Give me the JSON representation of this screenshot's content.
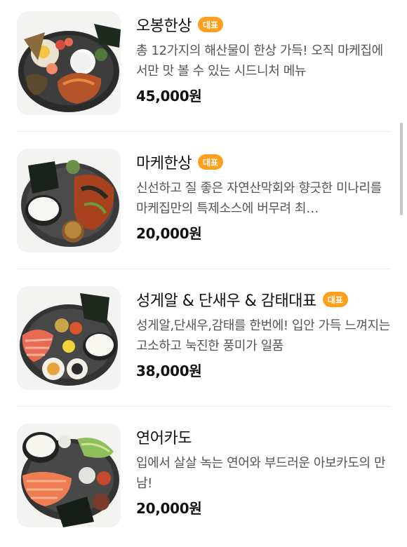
{
  "menu": {
    "items": [
      {
        "name": "오봉한상",
        "badge": "대표",
        "description": "총 12가지의 해산물이 한상 가득! 오직 마케집에서만 맛 볼 수 있는 시드니처 메뉴",
        "price": "45,000원",
        "image": "seafood-platter-photo"
      },
      {
        "name": "마케한상",
        "badge": "대표",
        "description": "신선하고 질 좋은 자연산막회와 향긋한 미나리를 마케집만의 특제소스에 버무려 최…",
        "price": "20,000원",
        "image": "raw-fish-salad-platter-photo"
      },
      {
        "name": "성게알 & 단새우 & 감태대표",
        "badge": "대표",
        "description": "성게알,단새우,감태를 한번에! 입안 가득 느껴지는 고소하고 눅진한 풍미가 일품",
        "price": "38,000원",
        "image": "sea-urchin-shrimp-platter-photo"
      },
      {
        "name": "연어카도",
        "badge": "",
        "description": "입에서 살살 녹는 연어와 부드러운 아보카도의 만남!",
        "price": "20,000원",
        "image": "salmon-avocado-platter-photo"
      }
    ]
  },
  "colors": {
    "badge": "#ff9f1c",
    "price": "#111111",
    "description": "#555555",
    "divider": "#ececec"
  }
}
